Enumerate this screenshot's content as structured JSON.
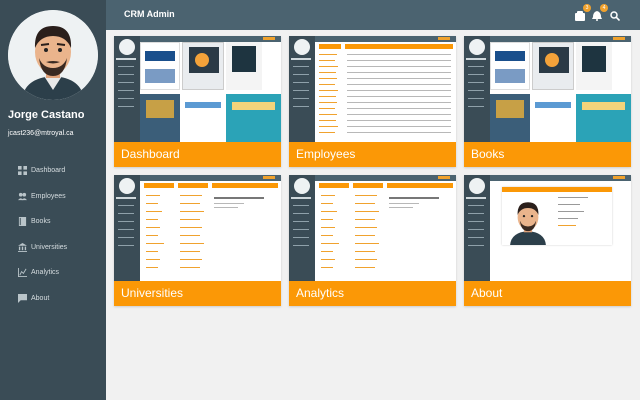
{
  "user": {
    "name": "Jorge Castano",
    "email": "jcast236@mtroyal.ca"
  },
  "nav": [
    {
      "label": "Dashboard",
      "icon": "dashboard-icon"
    },
    {
      "label": "Employees",
      "icon": "people-icon"
    },
    {
      "label": "Books",
      "icon": "book-icon"
    },
    {
      "label": "Universities",
      "icon": "university-icon"
    },
    {
      "label": "Analytics",
      "icon": "chart-icon"
    },
    {
      "label": "About",
      "icon": "chat-icon"
    }
  ],
  "header": {
    "title": "CRM Admin",
    "cart_badge": "3",
    "bell_badge": "4"
  },
  "cards": [
    {
      "label": "Dashboard"
    },
    {
      "label": "Employees"
    },
    {
      "label": "Books"
    },
    {
      "label": "Universities"
    },
    {
      "label": "Analytics"
    },
    {
      "label": "About"
    }
  ],
  "colors": {
    "sidebar": "#3a4c56",
    "header": "#4b6370",
    "accent": "#fb9806"
  }
}
